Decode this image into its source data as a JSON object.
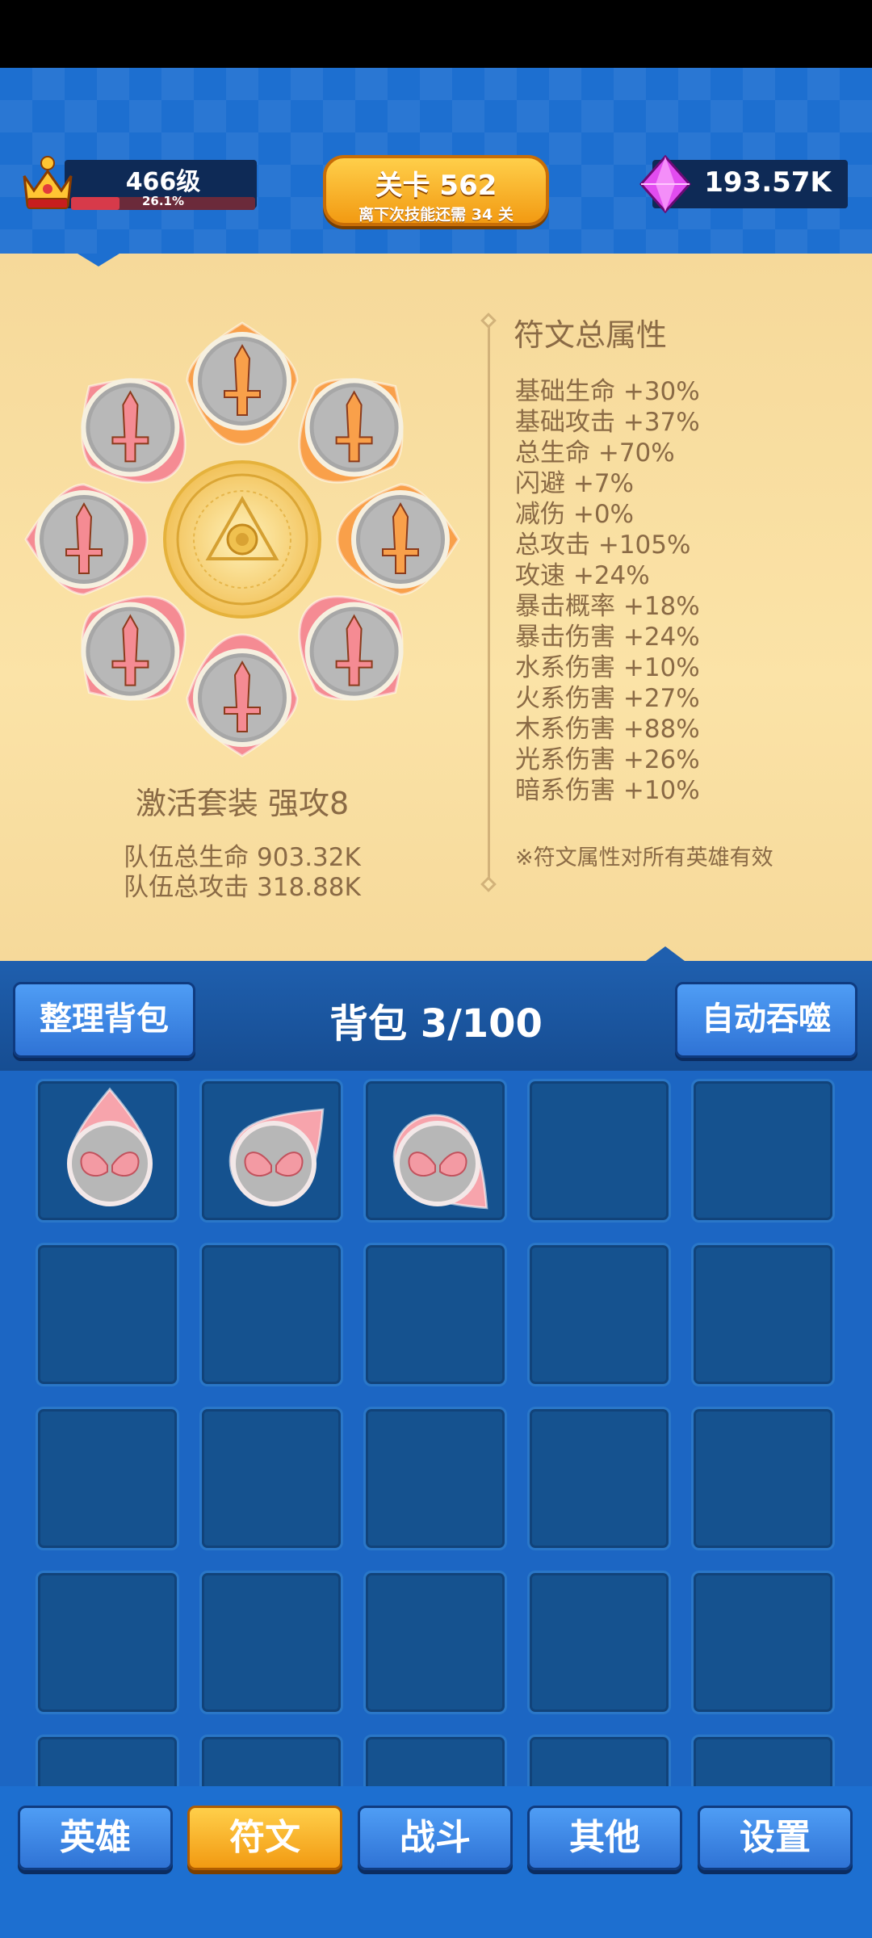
{
  "hud": {
    "level_label": "466级",
    "level_progress_text": "26.1%",
    "level_progress": 0.261,
    "stage_title": "关卡 562",
    "stage_sub": "离下次技能还需 34 关",
    "gems": "193.57K",
    "crown_icon": "crown-icon",
    "gem_icon": "pink-gem-icon"
  },
  "runes": {
    "set_title": "激活套装  强攻8",
    "team_hp": "队伍总生命 903.32K",
    "team_atk": "队伍总攻击 318.88K",
    "slots": [
      {
        "color": "orange",
        "icon": "sword-icon"
      },
      {
        "color": "orange",
        "icon": "sword-icon"
      },
      {
        "color": "orange",
        "icon": "sword-icon"
      },
      {
        "color": "pink",
        "icon": "sword-icon"
      },
      {
        "color": "pink",
        "icon": "sword-icon"
      },
      {
        "color": "pink",
        "icon": "sword-icon"
      },
      {
        "color": "pink",
        "icon": "sword-icon"
      },
      {
        "color": "pink",
        "icon": "sword-icon"
      }
    ]
  },
  "attributes": {
    "heading": "符文总属性",
    "items": [
      "基础生命 +30%",
      "基础攻击 +37%",
      "总生命 +70%",
      "闪避 +7%",
      "减伤 +0%",
      "总攻击 +105%",
      "攻速 +24%",
      "暴击概率 +18%",
      "暴击伤害 +24%",
      "水系伤害 +10%",
      "火系伤害 +27%",
      "木系伤害 +88%",
      "光系伤害 +26%",
      "暗系伤害 +10%"
    ],
    "note": "※符文属性对所有英雄有效"
  },
  "bag": {
    "sort_label": "整理背包",
    "title": "背包 3/100",
    "auto_label": "自动吞噬",
    "items": [
      "wing-rune-icon",
      "wing-rune-icon",
      "wing-rune-icon"
    ]
  },
  "tabs": [
    {
      "label": "英雄",
      "active": false
    },
    {
      "label": "符文",
      "active": true
    },
    {
      "label": "战斗",
      "active": false
    },
    {
      "label": "其他",
      "active": false
    },
    {
      "label": "设置",
      "active": false
    }
  ],
  "colors": {
    "orange_rune": "#f9a04a",
    "pink_rune": "#f58b93",
    "parchment": "#fbe3a7",
    "text_brown": "#8a6a45"
  }
}
